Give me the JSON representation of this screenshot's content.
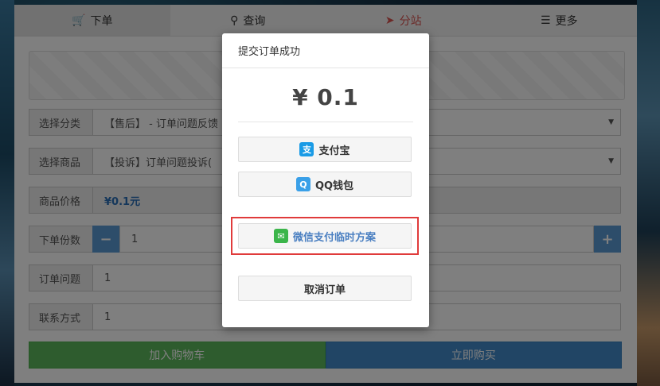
{
  "tabs": [
    {
      "label": "下单",
      "icon": "cart-icon"
    },
    {
      "label": "查询",
      "icon": "search-icon"
    },
    {
      "label": "分站",
      "icon": "send-icon"
    },
    {
      "label": "更多",
      "icon": "list-icon"
    }
  ],
  "form": {
    "category": {
      "label": "选择分类",
      "value": "【售后】 - 订单问题反馈"
    },
    "product": {
      "label": "选择商品",
      "value": "【投诉】订单问题投诉("
    },
    "price": {
      "label": "商品价格",
      "value": "¥0.1元"
    },
    "quantity": {
      "label": "下单份数",
      "value": "1",
      "minus": "−",
      "plus": "+"
    },
    "issue": {
      "label": "订单问题",
      "value": "1"
    },
    "contact": {
      "label": "联系方式",
      "value": "1"
    }
  },
  "actions": {
    "add_to_cart": "加入购物车",
    "buy_now": "立即购买"
  },
  "modal": {
    "title": "提交订单成功",
    "amount": "¥ 0.1",
    "alipay": "支付宝",
    "qq": "QQ钱包",
    "wechat": "微信支付临时方案",
    "cancel": "取消订单"
  },
  "colors": {
    "accent": "#d9534f",
    "green": "#5cb85c",
    "blue": "#428bca",
    "highlight": "#e03b3b"
  }
}
